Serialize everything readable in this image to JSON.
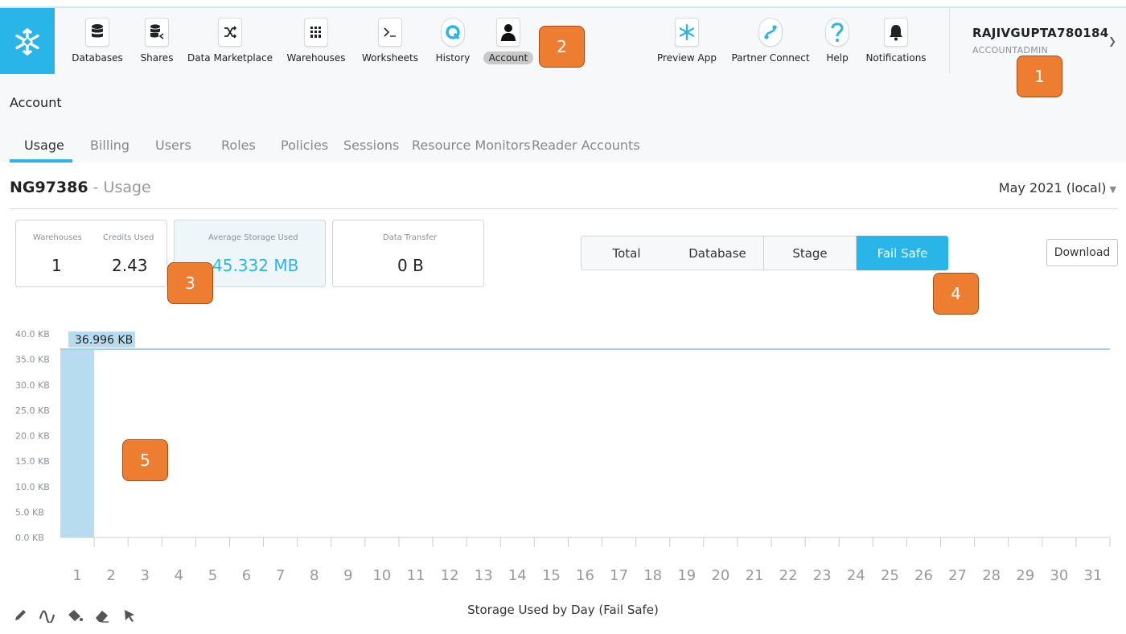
{
  "nav": {
    "items": [
      {
        "label": "Databases",
        "icon": "database-icon"
      },
      {
        "label": "Shares",
        "icon": "share-icon"
      },
      {
        "label": "Data Marketplace",
        "icon": "marketplace-icon"
      },
      {
        "label": "Warehouses",
        "icon": "warehouse-icon"
      },
      {
        "label": "Worksheets",
        "icon": "terminal-icon"
      },
      {
        "label": "History",
        "icon": "history-icon"
      },
      {
        "label": "Account",
        "icon": "account-icon",
        "active": true
      }
    ],
    "right_items": [
      {
        "label": "Preview App",
        "icon": "snowflake-icon"
      },
      {
        "label": "Partner Connect",
        "icon": "partner-connect-icon"
      },
      {
        "label": "Help",
        "icon": "help-icon"
      },
      {
        "label": "Notifications",
        "icon": "bell-icon"
      }
    ]
  },
  "user": {
    "name": "RAJIVGUPTA780184",
    "role": "ACCOUNTADMIN"
  },
  "header": {
    "title": "Account"
  },
  "tabs": [
    {
      "label": "Usage",
      "active": true
    },
    {
      "label": "Billing"
    },
    {
      "label": "Users"
    },
    {
      "label": "Roles"
    },
    {
      "label": "Policies"
    },
    {
      "label": "Sessions"
    },
    {
      "label": "Resource Monitors"
    },
    {
      "label": "Reader Accounts"
    }
  ],
  "page": {
    "account_id": "NG97386",
    "separator": " - ",
    "subtitle": "Usage",
    "month": "May 2021 (local)"
  },
  "stats": {
    "warehouses_label": "Warehouses",
    "warehouses_value": "1",
    "credits_label": "Credits Used",
    "credits_value": "2.43",
    "storage_label": "Average Storage Used",
    "storage_value": "45.332 MB",
    "transfer_label": "Data Transfer",
    "transfer_value": "0 B"
  },
  "segments": [
    {
      "label": "Total"
    },
    {
      "label": "Database"
    },
    {
      "label": "Stage"
    },
    {
      "label": "Fail Safe",
      "active": true
    }
  ],
  "download_label": "Download",
  "markers": [
    "1",
    "2",
    "3",
    "4",
    "5"
  ],
  "colors": {
    "accent": "#29b5e8",
    "marker": "#ed7d31",
    "bar": "#b8dcef"
  },
  "chart_data": {
    "type": "bar",
    "title": "Storage Used by Day (Fail Safe)",
    "unit": "KB",
    "categories": [
      "1",
      "2",
      "3",
      "4",
      "5",
      "6",
      "7",
      "8",
      "9",
      "10",
      "11",
      "12",
      "13",
      "14",
      "15",
      "16",
      "17",
      "18",
      "19",
      "20",
      "21",
      "22",
      "23",
      "24",
      "25",
      "26",
      "27",
      "28",
      "29",
      "30",
      "31"
    ],
    "values": [
      36.996,
      null,
      null,
      null,
      null,
      null,
      null,
      null,
      null,
      null,
      null,
      null,
      null,
      null,
      null,
      null,
      null,
      null,
      null,
      null,
      null,
      null,
      null,
      null,
      null,
      null,
      null,
      null,
      null,
      null,
      null
    ],
    "ylim": [
      0,
      40
    ],
    "yticks": [
      "0.0 KB",
      "5.0 KB",
      "10.0 KB",
      "15.0 KB",
      "20.0 KB",
      "25.0 KB",
      "30.0 KB",
      "35.0 KB",
      "40.0 KB"
    ],
    "reference_line": {
      "value": 36.996,
      "label": "36.996 KB"
    },
    "grid": false,
    "legend": "none"
  },
  "tools": [
    "pencil-icon",
    "curve-icon",
    "paint-bucket-icon",
    "eraser-icon",
    "pointer-icon"
  ]
}
